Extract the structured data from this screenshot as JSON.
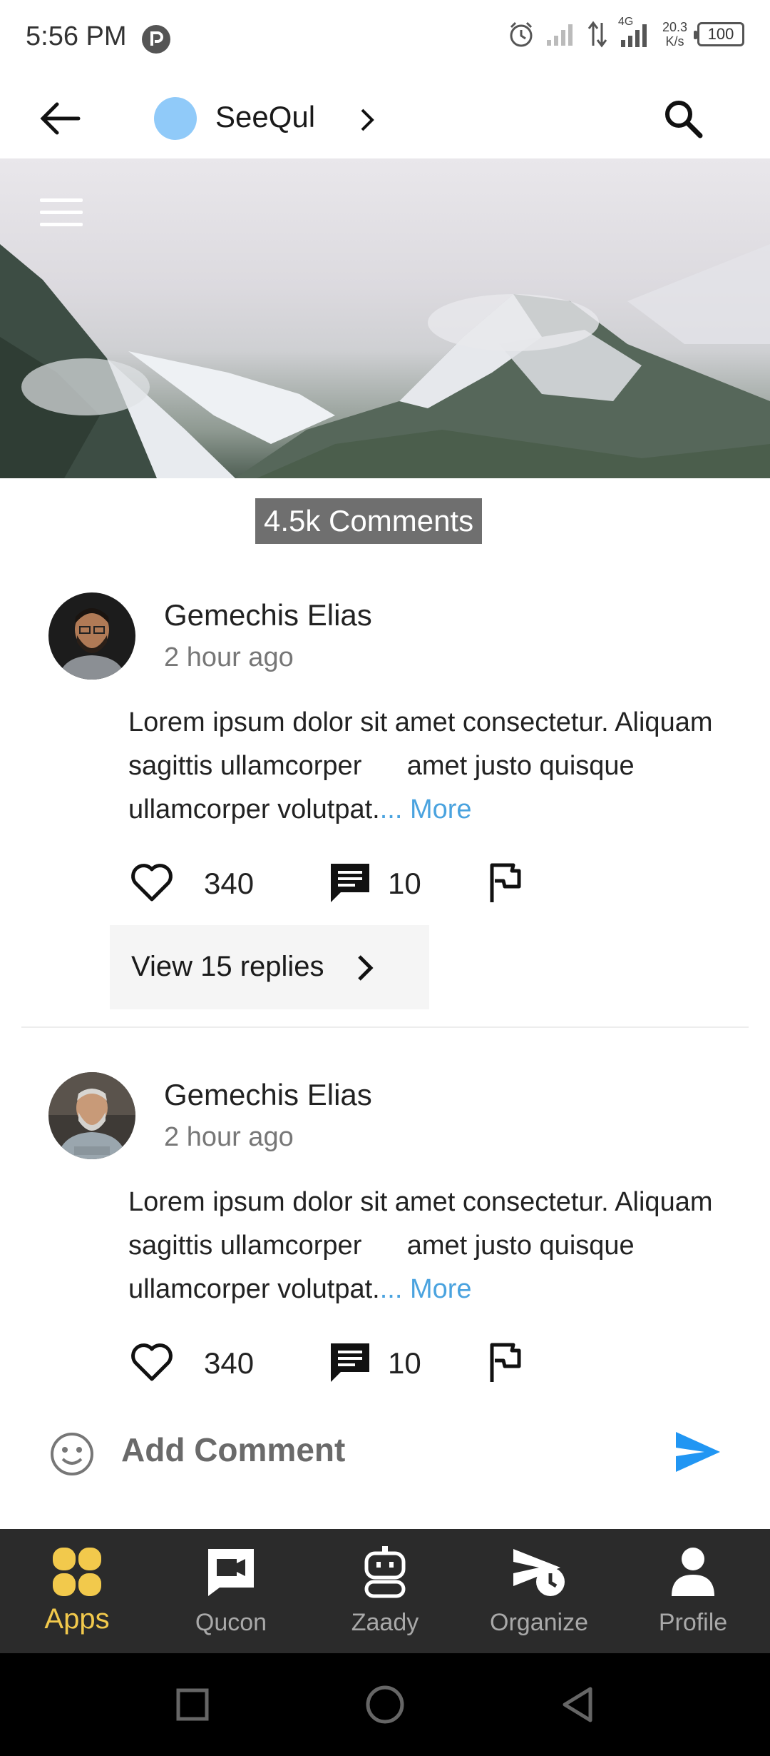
{
  "status_bar": {
    "time": "5:56 PM",
    "net_speed_value": "20.3",
    "net_speed_unit": "K/s",
    "network": "4G",
    "battery": "100"
  },
  "app_bar": {
    "channel_name": "SeeQul",
    "channel_color": "#90caf9"
  },
  "comments_header": {
    "count_label": "4.5k Comments"
  },
  "comments": [
    {
      "author": "Gemechis Elias",
      "time": "2 hour ago",
      "text": "Lorem ipsum dolor sit amet consectetur. Aliquam sagittis ullamcorper      amet justo quisque         ullamcorper volutpat.",
      "more_label": "... More",
      "likes": "340",
      "replies_count": "10",
      "view_replies_label": "View 15 replies"
    },
    {
      "author": "Gemechis Elias",
      "time": "2 hour ago",
      "text": "Lorem ipsum dolor sit amet consectetur. Aliquam sagittis ullamcorper      amet justo quisque         ullamcorper volutpat.",
      "more_label": "... More",
      "likes": "340",
      "replies_count": "10"
    }
  ],
  "add_comment": {
    "placeholder": "Add Comment",
    "send_color": "#2196f3"
  },
  "bottom_nav": {
    "items": [
      {
        "label": "Apps",
        "icon": "apps-grid-icon",
        "active": true
      },
      {
        "label": "Qucon",
        "icon": "video-message-icon",
        "active": false
      },
      {
        "label": "Zaady",
        "icon": "robot-icon",
        "active": false
      },
      {
        "label": "Organize",
        "icon": "schedule-send-icon",
        "active": false
      },
      {
        "label": "Profile",
        "icon": "person-icon",
        "active": false
      }
    ],
    "active_color": "#f2c94c"
  }
}
